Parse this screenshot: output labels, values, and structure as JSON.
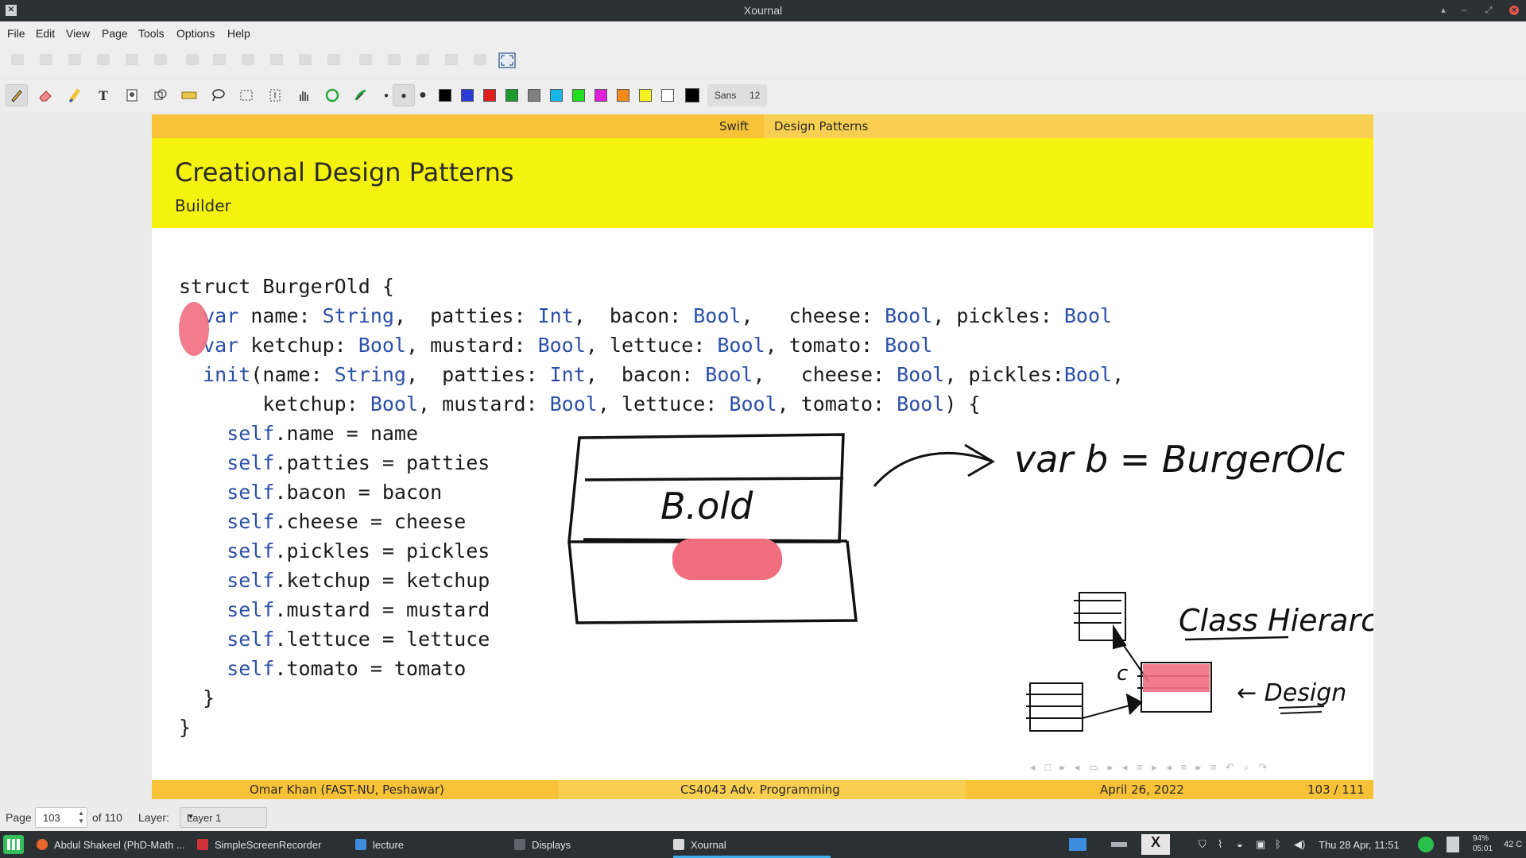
{
  "window": {
    "title": "Xournal"
  },
  "menu": [
    "File",
    "Edit",
    "View",
    "Page",
    "Tools",
    "Options",
    "Help"
  ],
  "toolbar": {
    "font_name": "Sans",
    "font_size": "12",
    "colors": [
      "#000000",
      "#2b3bd6",
      "#e01e1e",
      "#1c9a2a",
      "#808080",
      "#17b6e8",
      "#20e020",
      "#e020d8",
      "#f28a1a",
      "#f4ef20",
      "#ffffff",
      "#000000"
    ]
  },
  "slide": {
    "header_section": "Swift",
    "header_subsection": "Design Patterns",
    "frame_title": "Creational Design Patterns",
    "frame_subtitle": "Builder",
    "footer_author": "Omar Khan (FAST-NU, Peshawar)",
    "footer_course": "CS4043 Adv. Programming",
    "footer_date": "April 26, 2022",
    "footer_pages": "103 / 111"
  },
  "code_lines": [
    [
      [
        "struct",
        "kw-plain"
      ],
      [
        " BurgerOld {",
        ""
      ]
    ],
    [
      [
        "  var",
        "kw"
      ],
      [
        " name: ",
        ""
      ],
      [
        "String",
        "kw"
      ],
      [
        ",  patties: ",
        ""
      ],
      [
        "Int",
        "kw"
      ],
      [
        ",  bacon: ",
        ""
      ],
      [
        "Bool",
        "kw"
      ],
      [
        ",   cheese: ",
        ""
      ],
      [
        "Bool",
        "kw"
      ],
      [
        ", pickles: ",
        ""
      ],
      [
        "Bool",
        "kw"
      ]
    ],
    [
      [
        "  var",
        "kw"
      ],
      [
        " ketchup: ",
        ""
      ],
      [
        "Bool",
        "kw"
      ],
      [
        ", mustard: ",
        ""
      ],
      [
        "Bool",
        "kw"
      ],
      [
        ", lettuce: ",
        ""
      ],
      [
        "Bool",
        "kw"
      ],
      [
        ", tomato: ",
        ""
      ],
      [
        "Bool",
        "kw"
      ]
    ],
    [
      [
        "  init",
        "kw"
      ],
      [
        "(name: ",
        ""
      ],
      [
        "String",
        "kw"
      ],
      [
        ",  patties: ",
        ""
      ],
      [
        "Int",
        "kw"
      ],
      [
        ",  bacon: ",
        ""
      ],
      [
        "Bool",
        "kw"
      ],
      [
        ",   cheese: ",
        ""
      ],
      [
        "Bool",
        "kw"
      ],
      [
        ", pickles:",
        ""
      ],
      [
        "Bool",
        "kw"
      ],
      [
        ",",
        ""
      ]
    ],
    [
      [
        "       ketchup: ",
        ""
      ],
      [
        "Bool",
        "kw"
      ],
      [
        ", mustard: ",
        ""
      ],
      [
        "Bool",
        "kw"
      ],
      [
        ", lettuce: ",
        ""
      ],
      [
        "Bool",
        "kw"
      ],
      [
        ", tomato: ",
        ""
      ],
      [
        "Bool",
        "kw"
      ],
      [
        ") {",
        ""
      ]
    ],
    [
      [
        "    self",
        "kw"
      ],
      [
        ".name = name",
        ""
      ]
    ],
    [
      [
        "    self",
        "kw"
      ],
      [
        ".patties = patties",
        ""
      ]
    ],
    [
      [
        "    self",
        "kw"
      ],
      [
        ".bacon = bacon",
        ""
      ]
    ],
    [
      [
        "    self",
        "kw"
      ],
      [
        ".cheese = cheese",
        ""
      ]
    ],
    [
      [
        "    self",
        "kw"
      ],
      [
        ".pickles = pickles",
        ""
      ]
    ],
    [
      [
        "    self",
        "kw"
      ],
      [
        ".ketchup = ketchup",
        ""
      ]
    ],
    [
      [
        "    self",
        "kw"
      ],
      [
        ".mustard = mustard",
        ""
      ]
    ],
    [
      [
        "    self",
        "kw"
      ],
      [
        ".lettuce = lettuce",
        ""
      ]
    ],
    [
      [
        "    self",
        "kw"
      ],
      [
        ".tomato = tomato",
        ""
      ]
    ],
    [
      [
        "  }",
        ""
      ]
    ],
    [
      [
        "}",
        ""
      ]
    ]
  ],
  "ink_text": {
    "box_label": "B.old",
    "arrow_text": "var b = BurgerOlc",
    "class_hierarchy": "Class Hierarchy",
    "c_label": "c",
    "design_label": "← Design"
  },
  "statusbar": {
    "page_label": "Page",
    "page_value": "103",
    "page_total": "of 110",
    "layer_label": "Layer:",
    "layer_value": "Layer 1"
  },
  "taskbar": {
    "tasks": [
      {
        "label": "Abdul Shakeel (PhD-Math ...",
        "color": "#e8642c"
      },
      {
        "label": "SimpleScreenRecorder",
        "color": "#d0323a"
      },
      {
        "label": "lecture",
        "color": "#3d8ce0"
      },
      {
        "label": "Displays",
        "color": "#60666a"
      },
      {
        "label": "Xournal",
        "color": "#d8d8d8"
      }
    ],
    "clock": "Thu 28 Apr, 11:51",
    "battery_pct": "94%",
    "battery_time": "05:01",
    "temp": "42 C"
  }
}
